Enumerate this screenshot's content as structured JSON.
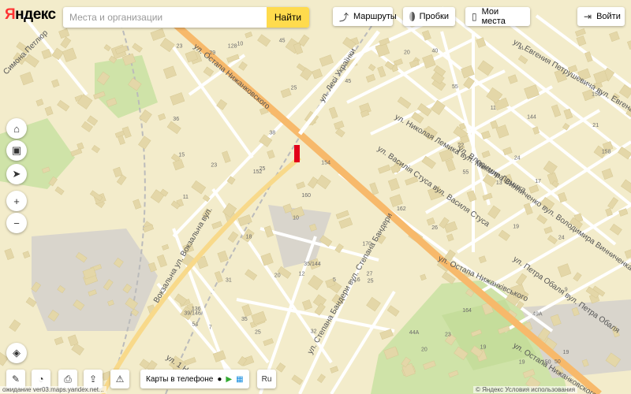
{
  "brand": {
    "logo_red": "Я",
    "logo_black": "ндекс"
  },
  "search": {
    "placeholder": "Места и организации",
    "value": "",
    "button": "Найти"
  },
  "topbar": {
    "routes": "Маршруты",
    "traffic": "Пробки",
    "my_places": "Мои места",
    "login": "Войти"
  },
  "bottom": {
    "phone_label": "Карты в телефоне",
    "status": "ожидание ver03.maps.yandex.net...",
    "copyright": "© Яндекс Условия использования"
  },
  "map": {
    "streets": {
      "main": "ул. Остапа Нижанківського",
      "main_ru": "ул. Остапа Нижанковского",
      "vokzalna": "Вокзальна ул. Вокзальна вул.",
      "vokzalna_top": "Вокзальна ул.",
      "lesi": "ул. Лесі Українки",
      "simona": "Симона Петлюр",
      "vasylia": "ул. Василія Стуса вул. Василя Стуса",
      "mykoly": "ул. Николая Лемика вул. Миколи Лемика",
      "volodymyra": "ул. Владимира Винниченко вул. Володимира Винниченка",
      "yevhena": "ул. Евгения Петрушевича вул. Евгена Петрушевича",
      "petra": "ул. Петра Обаля вул. Петра Обаля",
      "stepana": "ул. Степана Бандери вул. Степана Бандери",
      "nova": "ул. Новая",
      "t1novyi": "ул. 1 Новый"
    },
    "house_numbers": [
      "170",
      "152",
      "128",
      "19",
      "50",
      "25",
      "16",
      "10",
      "12",
      "13",
      "17",
      "20",
      "23",
      "19",
      "160",
      "164",
      "162",
      "158",
      "156",
      "154",
      "150",
      "25",
      "23",
      "20",
      "49А",
      "55",
      "44А",
      "136",
      "144",
      "39/146",
      "35/144",
      "5",
      "7",
      "9",
      "11",
      "15",
      "23",
      "10",
      "18",
      "32",
      "11",
      "19",
      "24",
      "19",
      "25",
      "54",
      "27",
      "38",
      "45",
      "55",
      "20",
      "24",
      "26",
      "41",
      "21",
      "22",
      "25",
      "29",
      "31",
      "35",
      "40",
      "45",
      "36"
    ],
    "colors": {
      "background": "#f3eccb",
      "main_road": "#f7b96b",
      "secondary_road": "#f8d98a",
      "park": "#cfe3a8",
      "building": "#e4d7a8",
      "industrial": "#d7d5cf",
      "marker": "#e2001a"
    }
  }
}
